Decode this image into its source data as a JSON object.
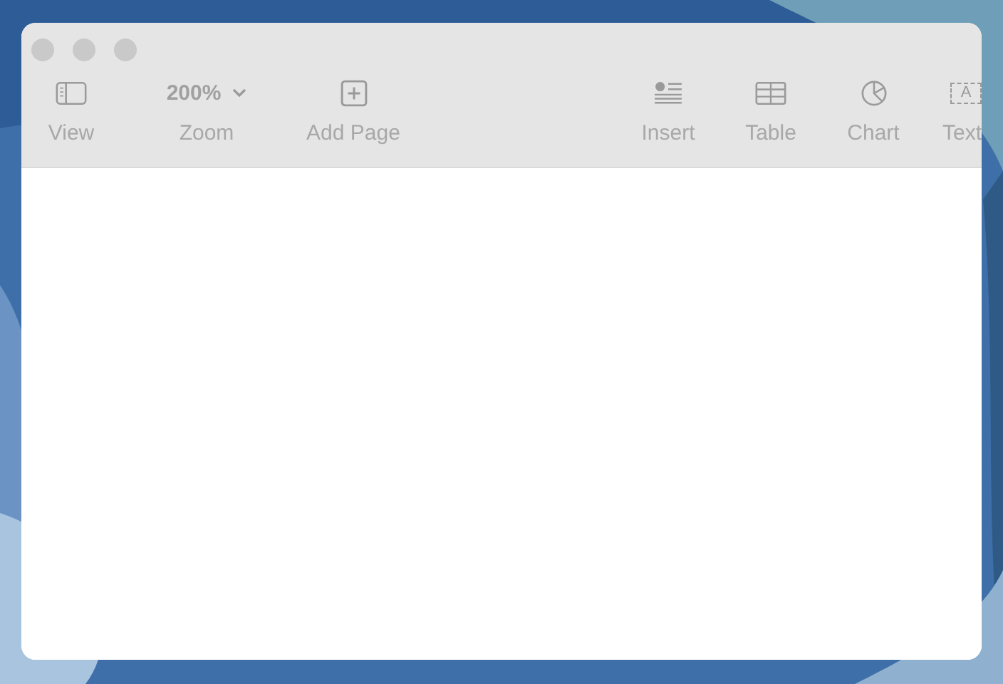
{
  "window": {
    "active": false
  },
  "toolbar": {
    "left": [
      {
        "kind": "sidebar",
        "label": "View"
      },
      {
        "kind": "dropdown",
        "label": "Zoom",
        "value": "200%"
      },
      {
        "kind": "add",
        "label": "Add Page"
      }
    ],
    "right": [
      {
        "kind": "insert",
        "label": "Insert"
      },
      {
        "kind": "table",
        "label": "Table"
      },
      {
        "kind": "chart",
        "label": "Chart"
      },
      {
        "kind": "textbox",
        "label": "Text",
        "glyph": "A"
      }
    ]
  }
}
